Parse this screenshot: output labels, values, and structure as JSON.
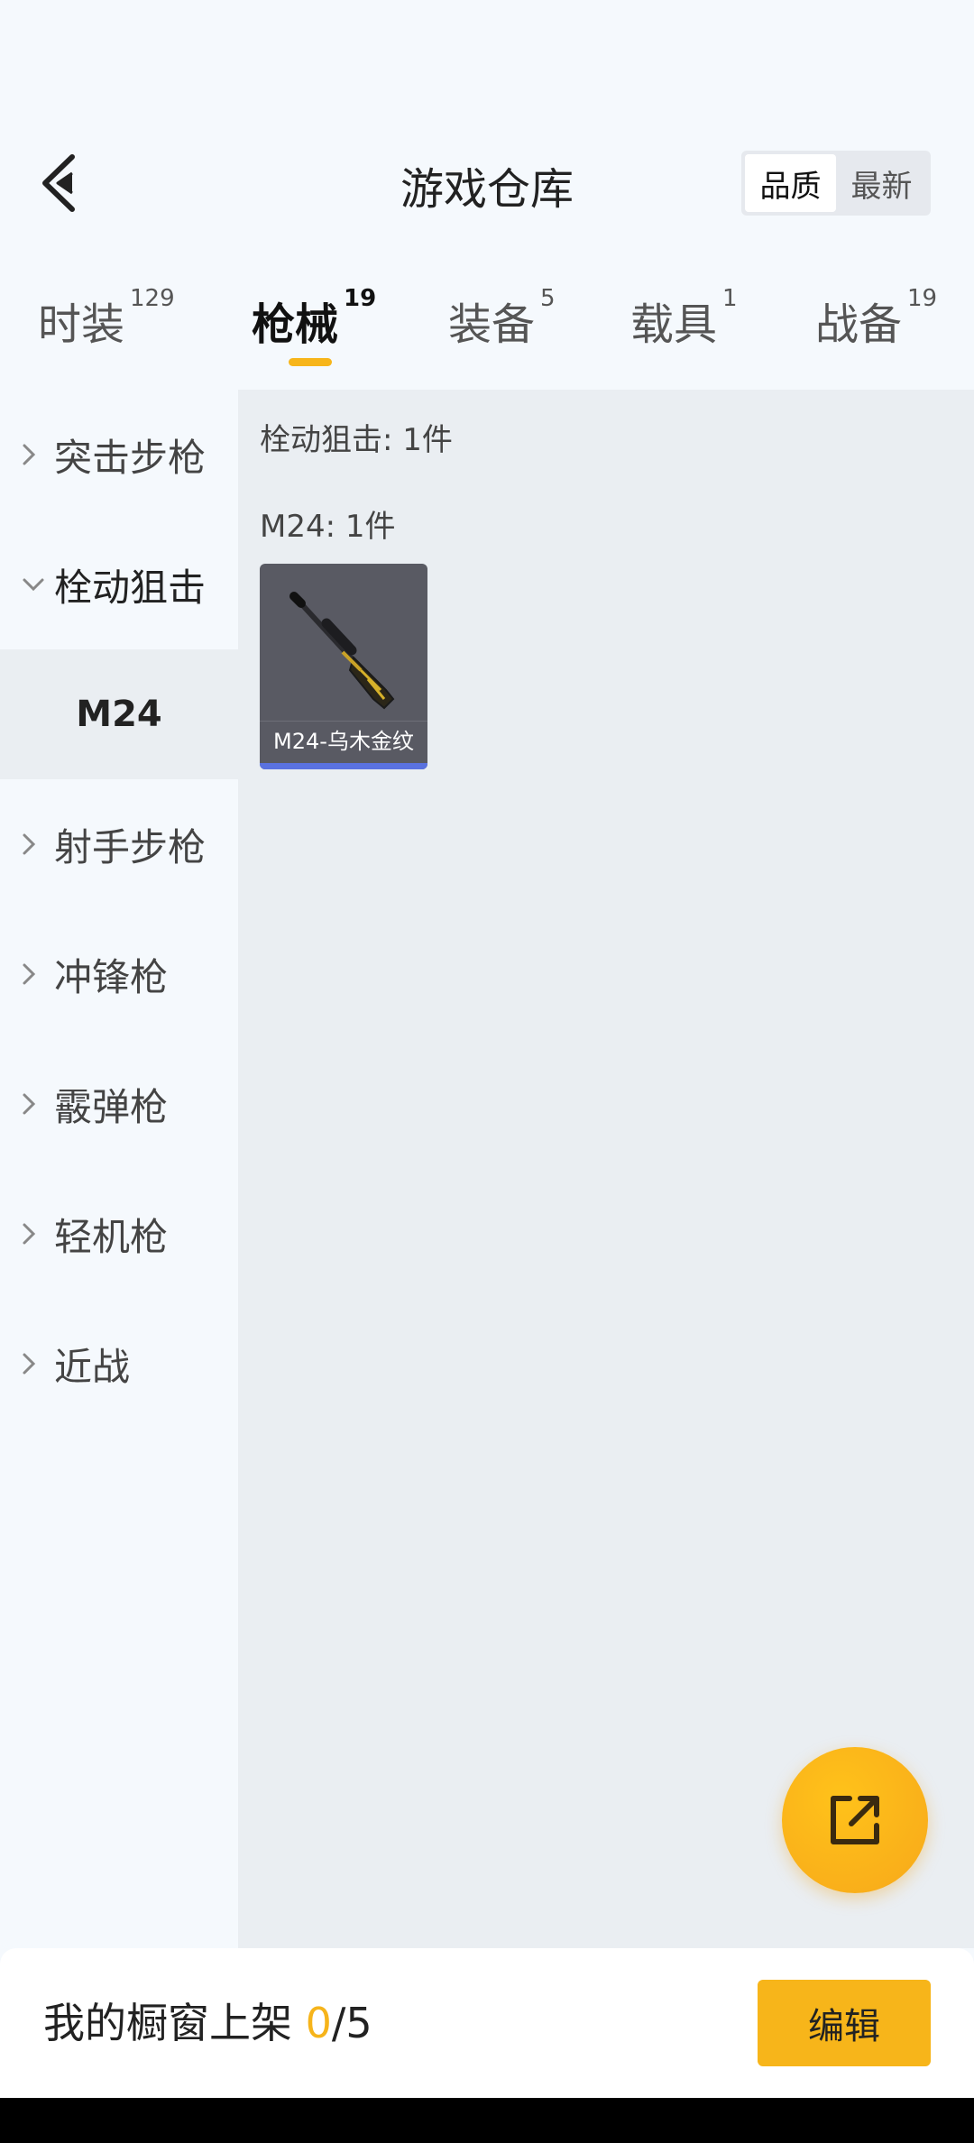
{
  "header": {
    "title": "游戏仓库",
    "sort_options": [
      "品质",
      "最新"
    ],
    "active_sort": "品质"
  },
  "tabs": [
    {
      "label": "时装",
      "count": "129",
      "active": false
    },
    {
      "label": "枪械",
      "count": "19",
      "active": true
    },
    {
      "label": "装备",
      "count": "5",
      "active": false
    },
    {
      "label": "载具",
      "count": "1",
      "active": false
    },
    {
      "label": "战备",
      "count": "19",
      "active": false
    }
  ],
  "sidebar": {
    "categories": [
      {
        "label": "突击步枪",
        "expanded": false
      },
      {
        "label": "栓动狙击",
        "expanded": true
      },
      {
        "label": "射手步枪",
        "expanded": false
      },
      {
        "label": "冲锋枪",
        "expanded": false
      },
      {
        "label": "霰弹枪",
        "expanded": false
      },
      {
        "label": "轻机枪",
        "expanded": false
      },
      {
        "label": "近战",
        "expanded": false
      }
    ],
    "subcategory": "M24"
  },
  "content": {
    "category_summary": "栓动狙击: 1件",
    "subcategory_summary": "M24: 1件",
    "items": [
      {
        "name": "M24-乌木金纹",
        "rarity_color": "#5a72e0"
      }
    ]
  },
  "bottom": {
    "shelf_label": "我的橱窗上架",
    "shelf_count": "0",
    "shelf_total": "/5",
    "edit_label": "编辑"
  },
  "colors": {
    "accent": "#f7b51a",
    "background": "#f5f9fd",
    "panel": "#eaeef2"
  },
  "icons": {
    "back": "chevron-left-icon",
    "fab": "share-external-icon",
    "category": "chevron-right-icon",
    "category_expanded": "chevron-down-icon"
  }
}
